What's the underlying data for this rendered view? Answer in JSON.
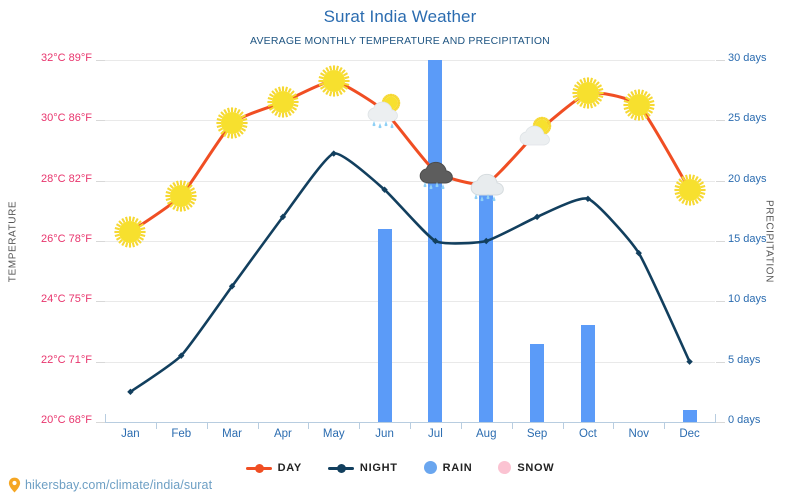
{
  "header": {
    "title": "Surat India Weather",
    "subtitle": "AVERAGE MONTHLY TEMPERATURE AND PRECIPITATION"
  },
  "axes": {
    "left_title": "TEMPERATURE",
    "right_title": "PRECIPITATION",
    "left_ticks": [
      "32°C 89°F",
      "30°C 86°F",
      "28°C 82°F",
      "26°C 78°F",
      "24°C 75°F",
      "22°C 71°F",
      "20°C 68°F"
    ],
    "right_ticks": [
      "30 days",
      "25 days",
      "20 days",
      "15 days",
      "10 days",
      "5 days",
      "0 days"
    ]
  },
  "legend": [
    {
      "label": "DAY",
      "style": "line",
      "color": "#f04e23"
    },
    {
      "label": "NIGHT",
      "style": "line",
      "color": "#123f5e"
    },
    {
      "label": "RAIN",
      "style": "dot",
      "color": "#6aa6ef"
    },
    {
      "label": "SNOW",
      "style": "dot",
      "color": "#fbc3d2"
    }
  ],
  "footer": {
    "url": "hikersbay.com/climate/india/surat",
    "pin_icon": "map-pin-icon"
  },
  "colors": {
    "day_line": "#f04e23",
    "night_line": "#123f5e",
    "rain_bar": "#5b9bf8",
    "snow": "#fbc3d2",
    "title": "#2b6cb0",
    "left_tick_text": "#e8356d",
    "right_tick_text": "#2b6cb0",
    "grid": "#e9e9e9"
  },
  "chart_data": {
    "type": "line",
    "title": "Surat India Weather",
    "subtitle": "AVERAGE MONTHLY TEMPERATURE AND PRECIPITATION",
    "xlabel": "",
    "ylabel": "TEMPERATURE",
    "y2label": "PRECIPITATION",
    "ylim": [
      20,
      32
    ],
    "y2lim": [
      0,
      30
    ],
    "y_unit": "°C",
    "y2_unit": "days",
    "grid": true,
    "legend_position": "bottom",
    "categories": [
      "Jan",
      "Feb",
      "Mar",
      "Apr",
      "May",
      "Jun",
      "Jul",
      "Aug",
      "Sep",
      "Oct",
      "Nov",
      "Dec"
    ],
    "series": [
      {
        "name": "DAY",
        "type": "line",
        "axis": "left",
        "color": "#f04e23",
        "values": [
          26.3,
          27.5,
          29.9,
          30.6,
          31.3,
          30.3,
          28.3,
          27.9,
          29.6,
          30.9,
          30.5,
          27.7
        ]
      },
      {
        "name": "NIGHT",
        "type": "line",
        "axis": "left",
        "color": "#123f5e",
        "values": [
          21.0,
          22.2,
          24.5,
          26.8,
          28.9,
          27.7,
          26.0,
          26.0,
          26.8,
          27.4,
          25.6,
          22.0
        ]
      },
      {
        "name": "RAIN",
        "type": "bar",
        "axis": "right",
        "color": "#5b9bf8",
        "values": [
          0,
          0,
          0,
          0,
          0,
          16,
          30,
          19,
          6.5,
          8,
          0,
          1
        ]
      },
      {
        "name": "SNOW",
        "type": "bar",
        "axis": "right",
        "color": "#fbc3d2",
        "values": [
          0,
          0,
          0,
          0,
          0,
          0,
          0,
          0,
          0,
          0,
          0,
          0
        ]
      }
    ],
    "weather_icons": [
      "sun",
      "sun",
      "sun",
      "sun",
      "sun",
      "sun-rain",
      "rain-heavy",
      "rain",
      "sun-cloud",
      "sun",
      "sun",
      "sun"
    ]
  }
}
